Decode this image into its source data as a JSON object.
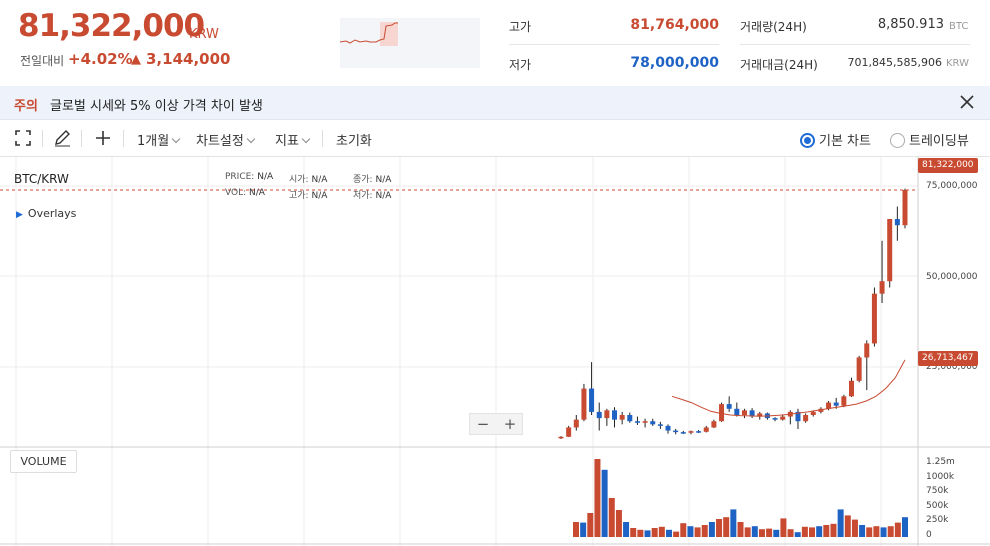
{
  "ticker": {
    "price": "81,322,000",
    "unit": "KRW",
    "change_label": "전일대비",
    "change_rate": "+4.02%",
    "change_arrow": "▲",
    "change_amount": "3,144,000",
    "high_label": "고가",
    "high_value": "81,764,000",
    "low_label": "저가",
    "low_value": "78,000,000",
    "volume_label": "거래량(24H)",
    "volume_value": "8,850.913",
    "volume_unit": "BTC",
    "amount_label": "거래대금(24H)",
    "amount_value": "701,845,585,906",
    "amount_unit": "KRW"
  },
  "notice": {
    "tag": "주의",
    "text": "글로벌 시세와 5% 이상 가격 차이 발생",
    "close_icon": "close-icon"
  },
  "toolbar": {
    "fullscreen_icon": "fullscreen-icon",
    "draw_icon": "pencil-icon",
    "crosshair_icon": "crosshair-icon",
    "period": "1개월",
    "chart_settings": "차트설정",
    "indicators": "지표",
    "reset": "초기화",
    "basic_chart": "기본 차트",
    "tradingview": "트레이딩뷰",
    "selected_mode": "기본 차트"
  },
  "chart": {
    "symbol": "BTC/KRW",
    "overlays": "Overlays",
    "info": {
      "price_label": "PRICE:",
      "price_value": "N/A",
      "open_label": "시가:",
      "open_value": "N/A",
      "close_label": "종가:",
      "close_value": "N/A",
      "vol_label": "VOL:",
      "vol_value": "N/A",
      "high_label": "고가:",
      "high_value": "N/A",
      "low_label": "저가:",
      "low_value": "N/A"
    },
    "zoom_out": "−",
    "zoom_in": "+",
    "volume_label": "VOLUME",
    "current_price_tag": "81,322,000",
    "ma_tag": "26,713,467",
    "price_ticks": [
      "75,000,000",
      "50,000,000",
      "25,000,000"
    ],
    "volume_ticks": [
      "1.25m",
      "1000k",
      "750k",
      "500k",
      "250k",
      "0"
    ],
    "colors": {
      "up": "#c84a31",
      "down": "#1e63c4",
      "ma": "#c84a31",
      "accent": "#1e6ad6"
    }
  },
  "chart_data": {
    "type": "candlestick",
    "price_range": [
      0,
      90000000
    ],
    "candles": [
      [
        1500000,
        2200000,
        1300000,
        2000000
      ],
      [
        2000000,
        5500000,
        1900000,
        5000000
      ],
      [
        5000000,
        9000000,
        4000000,
        7500000
      ],
      [
        7500000,
        19000000,
        7000000,
        17500000
      ],
      [
        17500000,
        26000000,
        9000000,
        10000000
      ],
      [
        10000000,
        13000000,
        4000000,
        8000000
      ],
      [
        8000000,
        11000000,
        5500000,
        10500000
      ],
      [
        10500000,
        11500000,
        5000000,
        7500000
      ],
      [
        7500000,
        10000000,
        6000000,
        9000000
      ],
      [
        9000000,
        9800000,
        6500000,
        7000000
      ],
      [
        7000000,
        8500000,
        5800000,
        6500000
      ],
      [
        6500000,
        7800000,
        5000000,
        7000000
      ],
      [
        7000000,
        7800000,
        5500000,
        6000000
      ],
      [
        6000000,
        6800000,
        4500000,
        5500000
      ],
      [
        5500000,
        6000000,
        3000000,
        4000000
      ],
      [
        4000000,
        4500000,
        2800000,
        3500000
      ],
      [
        3500000,
        3900000,
        2900000,
        3300000
      ],
      [
        3300000,
        4000000,
        2800000,
        3800000
      ],
      [
        3800000,
        4200000,
        3200000,
        3600000
      ],
      [
        3600000,
        5500000,
        3400000,
        5000000
      ],
      [
        5000000,
        7500000,
        4800000,
        7000000
      ],
      [
        7000000,
        13000000,
        6800000,
        12500000
      ],
      [
        12500000,
        15000000,
        10000000,
        11000000
      ],
      [
        11000000,
        13000000,
        8500000,
        9000000
      ],
      [
        9000000,
        11000000,
        8000000,
        10500000
      ],
      [
        10500000,
        11200000,
        8000000,
        8500000
      ],
      [
        8500000,
        10000000,
        7500000,
        9500000
      ],
      [
        9500000,
        9800000,
        7500000,
        8000000
      ],
      [
        8000000,
        8300000,
        7000000,
        7500000
      ],
      [
        7500000,
        9000000,
        7200000,
        8500000
      ],
      [
        8500000,
        10500000,
        6000000,
        10000000
      ],
      [
        10000000,
        11000000,
        4500000,
        7000000
      ],
      [
        7000000,
        9500000,
        6500000,
        9000000
      ],
      [
        9000000,
        10500000,
        8500000,
        10000000
      ],
      [
        10000000,
        11500000,
        9500000,
        11000000
      ],
      [
        11000000,
        13500000,
        10500000,
        13000000
      ],
      [
        13000000,
        14500000,
        11000000,
        12000000
      ],
      [
        12000000,
        15500000,
        11500000,
        15000000
      ],
      [
        15000000,
        21000000,
        14800000,
        20000000
      ],
      [
        20000000,
        28000000,
        19500000,
        27500000
      ],
      [
        27500000,
        33000000,
        17000000,
        32000000
      ],
      [
        32000000,
        50000000,
        31000000,
        48000000
      ],
      [
        48000000,
        65000000,
        45000000,
        52000000
      ],
      [
        52000000,
        70000000,
        50000000,
        72000000
      ],
      [
        72000000,
        76000000,
        65000000,
        70000000
      ],
      [
        70000000,
        81764000,
        69000000,
        81322000
      ]
    ],
    "ma_line": [
      15000000,
      14000000,
      13000000,
      11500000,
      10200000,
      9500000,
      9000000,
      8800000,
      8700000,
      8600000,
      8700000,
      8900000,
      9200000,
      9600000,
      10000000,
      10500000,
      11000000,
      11500000,
      12000000,
      12500000,
      13500000,
      15000000,
      17500000,
      21000000,
      26713467
    ],
    "volumes_k": [
      250,
      240,
      400,
      1300,
      1120,
      650,
      450,
      250,
      150,
      120,
      110,
      150,
      170,
      120,
      90,
      230,
      180,
      160,
      200,
      250,
      300,
      330,
      460,
      250,
      160,
      180,
      130,
      140,
      120,
      310,
      130,
      80,
      170,
      160,
      180,
      200,
      220,
      460,
      360,
      290,
      200,
      160,
      180,
      160,
      180,
      240,
      330
    ],
    "volume_range": [
      0,
      1250
    ]
  }
}
